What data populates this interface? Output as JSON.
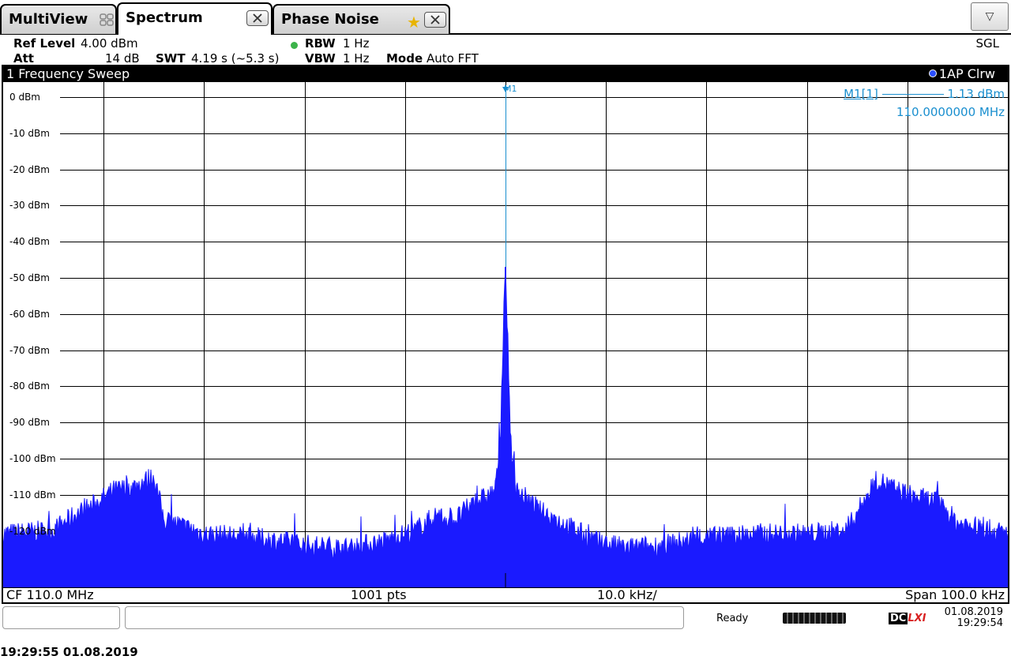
{
  "tabs": [
    {
      "label": "MultiView",
      "icon": "multiview-grid-icon"
    },
    {
      "label": "Spectrum",
      "icon": "close-icon"
    },
    {
      "label": "Phase Noise",
      "icon": "star-icon"
    }
  ],
  "menu_icon": "triangle-down-icon",
  "settings": {
    "ref_level_label": "Ref Level",
    "ref_level_value": "4.00 dBm",
    "att_label": "Att",
    "att_value": "14 dB",
    "swt_label": "SWT",
    "swt_value": "4.19 s (~5.3 s)",
    "rbw_label": "RBW",
    "rbw_value": "1 Hz",
    "vbw_label": "VBW",
    "vbw_value": "1 Hz",
    "mode_label": "Mode",
    "mode_value": "Auto FFT",
    "sgl": "SGL"
  },
  "diagram": {
    "title": "1 Frequency Sweep",
    "trace_label": "1AP Clrw",
    "marker_label": "M1",
    "marker_readout": {
      "name": "M1[1]",
      "level": "1.13 dBm",
      "freq": "110.0000000 MHz"
    },
    "footer": {
      "cf": "CF 110.0 MHz",
      "pts": "1001 pts",
      "div": "10.0 kHz/",
      "span": "Span 100.0 kHz"
    }
  },
  "chart_data": {
    "type": "line",
    "title": "1 Frequency Sweep",
    "y_tick_labels": [
      "0 dBm",
      "-10 dBm",
      "-20 dBm",
      "-30 dBm",
      "-40 dBm",
      "-50 dBm",
      "-60 dBm",
      "-70 dBm",
      "-80 dBm",
      "-90 dBm",
      "-100 dBm",
      "-110 dBm",
      "-120 dBm"
    ],
    "y_ticks": [
      0,
      -10,
      -20,
      -30,
      -40,
      -50,
      -60,
      -70,
      -80,
      -90,
      -100,
      -110,
      -120
    ],
    "ylim": [
      -136,
      4
    ],
    "xlim": [
      -50,
      50
    ],
    "x_unit": "kHz offset from CF",
    "grid": true,
    "trace_color": "#1a1aff",
    "series": [
      {
        "x": [
          -50,
          -45,
          -43,
          -41,
          -39,
          -37,
          -35,
          -34,
          -30,
          -25,
          -20,
          -16,
          -12,
          -9,
          -7,
          -5,
          -3,
          -2,
          -1,
          -0.5,
          0,
          0.5,
          1,
          2,
          3,
          5,
          7,
          9,
          12,
          16,
          20,
          25,
          30,
          34,
          35,
          37,
          39,
          41,
          43,
          45,
          50
        ],
        "y": [
          -122,
          -121,
          -117,
          -114,
          -110,
          -109,
          -106,
          -118,
          -122,
          -123,
          -125,
          -126,
          -124,
          -121,
          -117,
          -118,
          -113,
          -112,
          -110,
          -95,
          -47,
          -95,
          -110,
          -112,
          -115,
          -118,
          -121,
          -124,
          -126,
          -125,
          -123,
          -122,
          -122,
          -121,
          -116,
          -107,
          -110,
          -112,
          -113,
          -119,
          -122
        ]
      }
    ],
    "marker": {
      "name": "M1",
      "x": 0,
      "y": 1.13
    }
  }
}
